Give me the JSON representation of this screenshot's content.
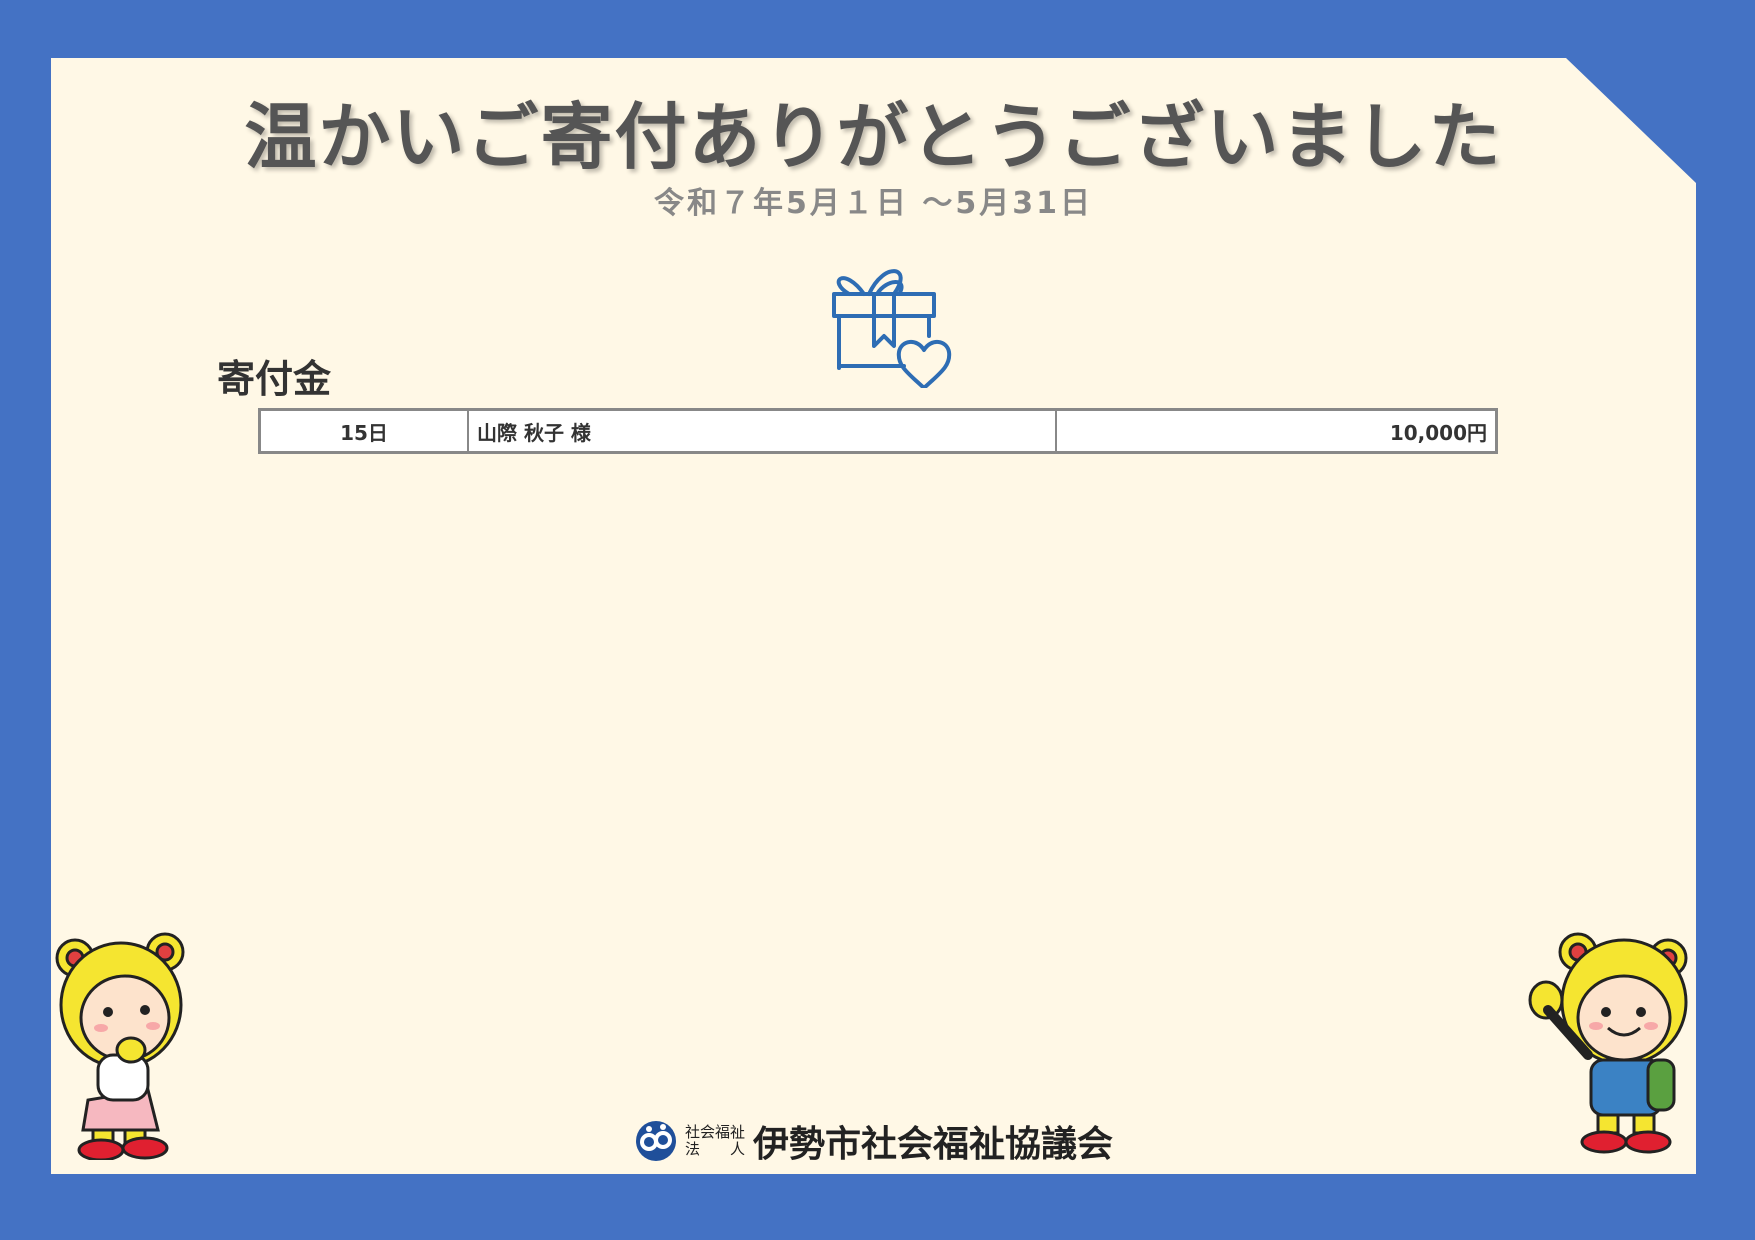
{
  "title": "温かいご寄付ありがとうございました",
  "period": "令和７年5月１日 ～5月31日",
  "section_heading": "寄付金",
  "donations": [
    {
      "day": "15日",
      "name": "山際 秋子 様",
      "amount": "10,000円"
    }
  ],
  "organization": {
    "prefix_line1": "社会福祉",
    "prefix_line2": "法　　人",
    "name": "伊勢市社会福祉協議会"
  },
  "colors": {
    "frame": "#4472c4",
    "background": "#fff8e6",
    "icon_blue": "#2e6db4"
  },
  "icons": {
    "gift": "gift-box-with-heart-icon",
    "logo": "organization-logo-icon",
    "mascots": [
      "mascot-bear-girl",
      "mascot-bear-boy"
    ]
  }
}
